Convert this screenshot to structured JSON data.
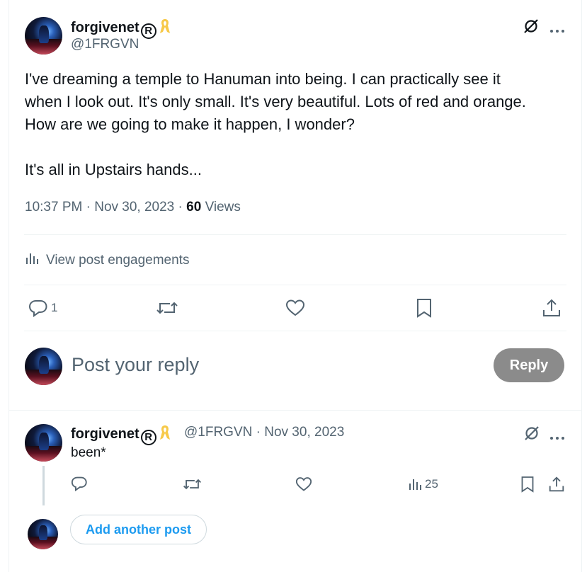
{
  "post": {
    "author_name": "forgivenet",
    "reg_mark": "R",
    "handle": "@1FRGVN",
    "lines": [
      "I've dreaming a temple to Hanuman into being. I can practically see it",
      "when I look out. It's only small. It's very beautiful. Lots of red and orange.",
      "How are we going to make it happen, I wonder?",
      "It's all in Upstairs hands..."
    ],
    "time": "10:37 PM",
    "date": "Nov 30, 2023",
    "views_count": "60",
    "views_label": "Views",
    "sep": "·",
    "engagements_label": "View post engagements",
    "reply_count": "1"
  },
  "composer": {
    "placeholder": "Post your reply",
    "reply_button": "Reply"
  },
  "reply": {
    "author_name": "forgivenet",
    "reg_mark": "R",
    "handle_date": "@1FRGVN · Nov 30, 2023",
    "text": "been*",
    "views_count": "25"
  },
  "add_post_label": "Add another post",
  "colors": {
    "accent": "#1d9bf0",
    "ribbon": "#f7c948",
    "muted": "#536471",
    "reply_button_disabled": "#8b8b8b"
  },
  "icons": [
    "grok-icon",
    "more-icon",
    "analytics-icon",
    "reply-icon",
    "repost-icon",
    "like-icon",
    "bookmark-icon",
    "share-icon",
    "awareness-ribbon-icon"
  ]
}
